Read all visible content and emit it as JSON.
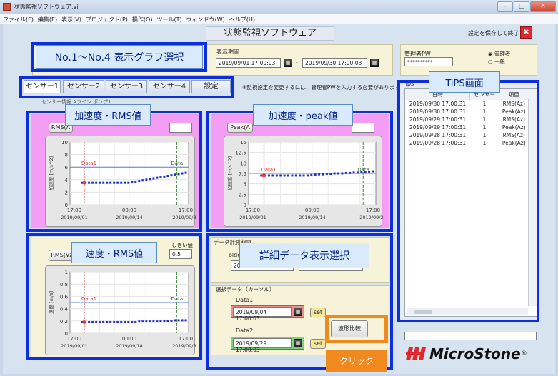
{
  "window": {
    "title": "状態監視ソフトウェア.vi"
  },
  "menu": [
    "ファイル(F)",
    "編集(E)",
    "表示(V)",
    "プロジェクト(P)",
    "操作(O)",
    "ツール(T)",
    "ウィンドウ(W)",
    "ヘルプ(H)"
  ],
  "header": {
    "app_title": "状態監視ソフトウェア",
    "save_exit_label": "設定を保存して終了",
    "close_symbol": "✖"
  },
  "period": {
    "label": "表示期間",
    "start": "2019/09/01 17:00:03",
    "sep": "-",
    "end": "2019/09/30 17:00:03"
  },
  "admin": {
    "label": "管理者PW",
    "password": "**********",
    "radio_admin": "管理者",
    "radio_general": "一般"
  },
  "tabs": [
    "センサー1",
    "センサー2",
    "センサー3",
    "センサー4",
    "設定"
  ],
  "notice": "※監視設定を変更するには、管理者PWを入力する必要があります。",
  "sensor_info": "センサー情報  Aライン ポンプ1",
  "annotations": {
    "graph_select": "No.1～No.4  表示グラフ選択",
    "tips_screen": "TiPS画面",
    "accel_rms": "加速度・RMS値",
    "accel_peak": "加速度・peak値",
    "vel_rms": "速度・RMS値",
    "detail_select": "詳細データ表示選択",
    "click": "クリック"
  },
  "graphs": {
    "g1": {
      "select": "RMS(A",
      "ylabel": "加速度 [m/s^2]",
      "yticks": [
        "10",
        "8",
        "6",
        "4",
        "2",
        "0"
      ],
      "xticks": [
        "17:00",
        "00:00",
        "17:00"
      ],
      "xdates": [
        "2019/09/01",
        "2019/09/14",
        "2019/09/30"
      ],
      "marker1": "Data1",
      "marker2": "Data",
      "threshold": 6.0,
      "ymax": 10,
      "series": [
        3.5,
        3.5,
        3.5,
        3.5,
        3.5,
        3.5,
        3.5,
        3.5,
        3.5,
        3.5,
        3.5,
        3.5,
        3.5,
        3.5,
        3.6,
        3.7,
        3.8,
        3.9,
        4.0,
        4.1,
        4.2,
        4.3,
        4.4,
        4.5,
        4.6,
        4.7,
        4.8,
        4.9,
        5.0,
        5.1
      ]
    },
    "g2": {
      "select": "Peak(A",
      "ylabel": "加速度 [m/s^2]",
      "yticks": [
        "15",
        "12.5",
        "10",
        "7.5",
        "5",
        "2.5",
        "0"
      ],
      "xticks": [
        "17:00",
        "00:00",
        "17:00"
      ],
      "xdates": [
        "2019/09/01",
        "2019/09/14",
        "2019/09/30"
      ],
      "marker1": "Data1",
      "marker2": "Data",
      "threshold": 7.5,
      "ymax": 15,
      "series": [
        7.0,
        7.0,
        7.0,
        7.0,
        7.0,
        7.0,
        7.0,
        7.0,
        7.0,
        7.0,
        7.0,
        7.0,
        7.0,
        7.1,
        7.2,
        7.3,
        7.3,
        7.4,
        7.4,
        7.5,
        7.5,
        7.5,
        7.6,
        7.6,
        7.7,
        7.7,
        7.8,
        7.8,
        7.9,
        8.0
      ]
    },
    "g3": {
      "select": "RMS(Vz)",
      "threshold_label": "しきい値",
      "threshold_value": "0.5",
      "ylabel": "速度 [m/s]",
      "yticks": [
        "1",
        "0.8",
        "0.6",
        "0.4",
        "0.2",
        "0"
      ],
      "xticks": [
        "17:00",
        "00:00",
        "17:00"
      ],
      "xdates": [
        "2019/09/01",
        "2019/09/14",
        "2019/09/30"
      ],
      "marker1": "Data1",
      "marker2": "Data",
      "threshold": 0.5,
      "ymax": 1,
      "series": [
        0.18,
        0.18,
        0.18,
        0.18,
        0.18,
        0.18,
        0.18,
        0.18,
        0.18,
        0.18,
        0.18,
        0.18,
        0.18,
        0.18,
        0.18,
        0.18,
        0.19,
        0.19,
        0.19,
        0.19,
        0.19,
        0.19,
        0.2,
        0.2,
        0.2,
        0.2,
        0.21,
        0.21,
        0.21,
        0.21
      ]
    }
  },
  "detail": {
    "compare_title": "データ計測期間",
    "older_label": "olde",
    "older_value": "20",
    "select_title": "選択データ（カーソル）",
    "data1_label": "Data1",
    "data1_value": "2019/09/04 17:00:03",
    "data2_label": "Data2",
    "data2_value": "2019/09/29 17:00:03",
    "set_label": "set",
    "compare_btn": "波形比較"
  },
  "tips": {
    "label": "Tips",
    "headers": [
      "日時",
      "センサー",
      "項目"
    ],
    "rows": [
      [
        "2019/09/30 17:00:31",
        "1",
        "RMS(Az)"
      ],
      [
        "2019/09/30 17:00:31",
        "1",
        "Peak(Az)"
      ],
      [
        "2019/09/29 17:00:31",
        "1",
        "RMS(Az)"
      ],
      [
        "2019/09/29 17:00:31",
        "1",
        "Peak(Az)"
      ],
      [
        "2019/09/28 17:00:31",
        "1",
        "RMS(Az)"
      ],
      [
        "2019/09/28 17:00:31",
        "1",
        "Peak(Az)"
      ]
    ]
  },
  "brand": {
    "name": "MicroStone",
    "reg": "®"
  },
  "colors": {
    "annotation_blue": "#0a2ee0",
    "orange": "#f08a1e",
    "pink": "#f39ef4",
    "series": "#1f2fd6",
    "threshold": "#5b7ce6"
  }
}
